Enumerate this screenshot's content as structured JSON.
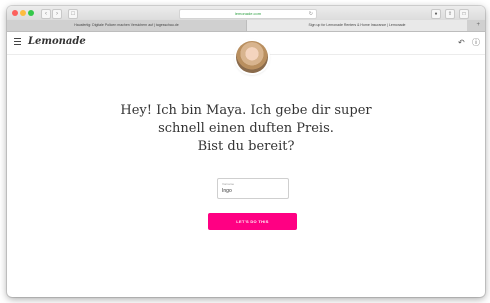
{
  "browser": {
    "address_url": "lemonade.com",
    "tabs": [
      {
        "label": "Hausfertig: Digitale Policen machen Versichern auf | tagesschau.de"
      },
      {
        "label": "Sign up for Lemonade Renters & Home Insurance | Lemonade"
      }
    ],
    "icons": {
      "back": "chevron-left-icon",
      "forward": "chevron-right-icon",
      "sidebar": "sidebar-icon",
      "reload": "reload-icon",
      "share": "share-icon",
      "tabs": "tabs-icon",
      "shield": "shield-icon",
      "new_tab": "plus-icon"
    }
  },
  "app": {
    "logo_text": "Lemonade",
    "menu_icon": "hamburger-icon",
    "undo_icon": "undo-icon",
    "help_icon": "help-icon",
    "avatar_name": "Maya",
    "headline_lines": [
      "Hey! Ich bin Maya. Ich gebe dir super",
      "schnell einen duften Preis.",
      "Bist du bereit?"
    ],
    "name_field": {
      "label": "Vorname",
      "value": "Ingo"
    },
    "cta_label": "LET'S DO THIS",
    "colors": {
      "cta": "#ff0083"
    }
  }
}
